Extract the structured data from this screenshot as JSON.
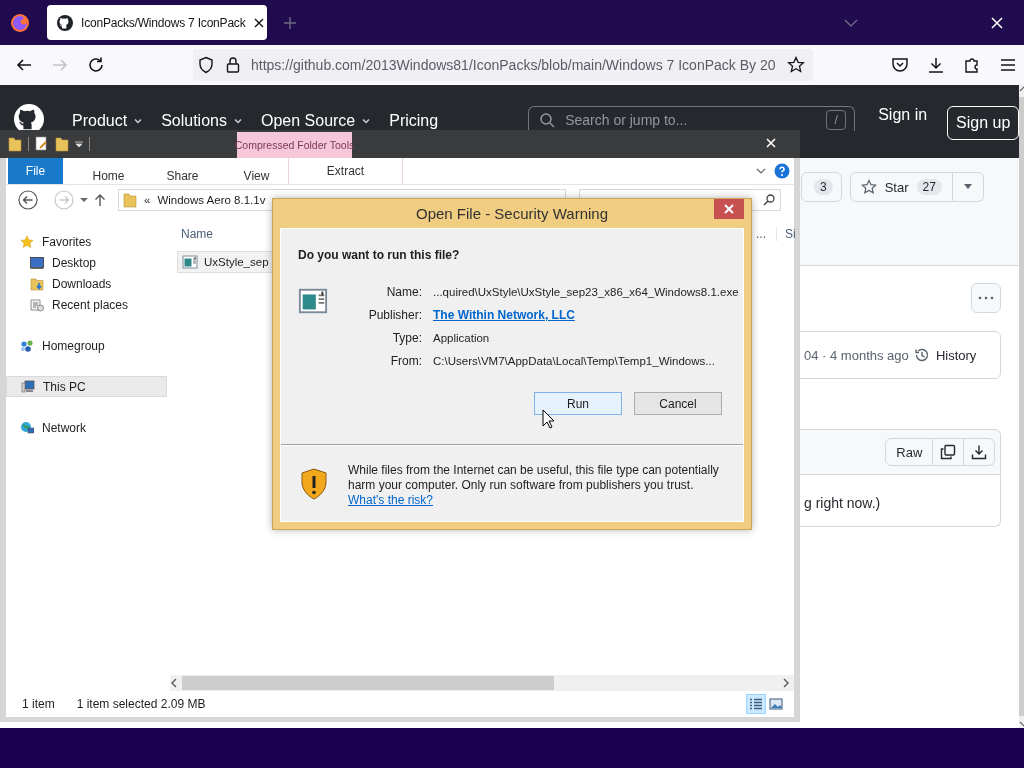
{
  "browser": {
    "tab": {
      "title": "IconPacks/Windows 7 IconPack",
      "selected": true
    },
    "url": "https://github.com/2013Windows81/IconPacks/blob/main/Windows 7 IconPack By 20",
    "forward_disabled": true
  },
  "github": {
    "nav": [
      {
        "label": "Product",
        "dropdown": true
      },
      {
        "label": "Solutions",
        "dropdown": true
      },
      {
        "label": "Open Source",
        "dropdown": true
      },
      {
        "label": "Pricing",
        "dropdown": false
      }
    ],
    "search": {
      "placeholder": "Search or jump to...",
      "shortcut": "/"
    },
    "sign_in": "Sign in",
    "sign_up": "Sign up",
    "fork_count": "3",
    "star": {
      "label": "Star",
      "count": "27"
    },
    "commit_age": "04 · 4 months ago",
    "history": "History",
    "raw": "Raw",
    "content_text": "g right now.)"
  },
  "explorer": {
    "context_tab": "Compressed Folder Tools",
    "ribbon_tabs": [
      {
        "label": "File",
        "kind": "menu"
      },
      {
        "label": "Home",
        "kind": "tab"
      },
      {
        "label": "Share",
        "kind": "tab"
      },
      {
        "label": "View",
        "kind": "tab"
      },
      {
        "label": "Extract",
        "kind": "context"
      }
    ],
    "address": {
      "prefix": "«",
      "path": "Windows Aero 8.1.1v"
    },
    "nav_pane": [
      {
        "label": "Favorites",
        "selected": false,
        "children": [
          {
            "label": "Desktop",
            "selected": false
          },
          {
            "label": "Downloads",
            "selected": false
          },
          {
            "label": "Recent places",
            "selected": false
          }
        ]
      },
      {
        "label": "Homegroup",
        "selected": false
      },
      {
        "label": "This PC",
        "selected": true
      },
      {
        "label": "Network",
        "selected": false
      }
    ],
    "columns": [
      "Name",
      "...",
      "Si"
    ],
    "files": [
      {
        "name": "UxStyle_sep",
        "selected": true
      }
    ],
    "status": {
      "count": "1 item",
      "selection": "1 item selected  2.09 MB"
    },
    "views": [
      {
        "kind": "details",
        "selected": true
      },
      {
        "kind": "tiles",
        "selected": false
      }
    ]
  },
  "dialog": {
    "title": "Open File - Security Warning",
    "question": "Do you want to run this file?",
    "fields": [
      {
        "label": "Name:",
        "value": "...quired\\UxStyle\\UxStyle_sep23_x86_x64_Windows8.1.exe",
        "kind": "text"
      },
      {
        "label": "Publisher:",
        "value": "The Within Network, LLC",
        "kind": "link"
      },
      {
        "label": "Type:",
        "value": "Application",
        "kind": "text"
      },
      {
        "label": "From:",
        "value": "C:\\Users\\VM7\\AppData\\Local\\Temp\\Temp1_Windows...",
        "kind": "text"
      }
    ],
    "buttons": [
      {
        "label": "Run",
        "focused": true
      },
      {
        "label": "Cancel",
        "focused": false
      }
    ],
    "warning": "While files from the Internet can be useful, this file type can potentially harm your computer. Only run software from publishers you trust.",
    "risk_link": "What's the risk?"
  }
}
